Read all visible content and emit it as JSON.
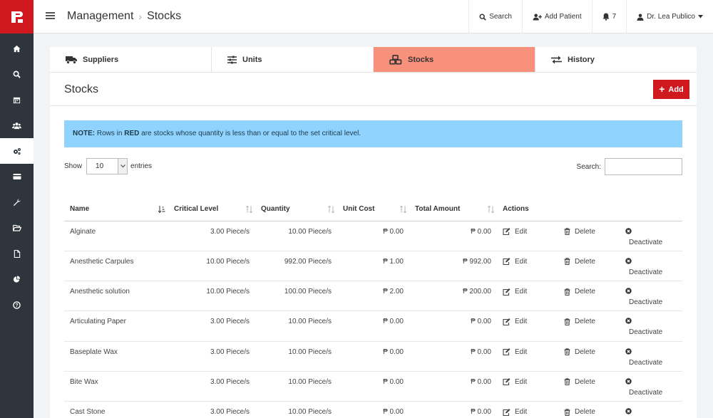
{
  "topbar": {
    "breadcrumb": [
      "Management",
      "Stocks"
    ],
    "search_label": "Search",
    "add_patient_label": "Add Patient",
    "notification_count": "7",
    "user_label": "Dr. Lea Publico"
  },
  "sidebar": {
    "items": [
      "home-icon",
      "search-icon",
      "calendar-icon",
      "users-icon",
      "cogs-icon",
      "credit-card-icon",
      "wrench-icon",
      "folder-open-icon",
      "file-icon",
      "pie-chart-icon",
      "help-icon"
    ],
    "active_index": 4
  },
  "tabs": [
    {
      "label": "Suppliers",
      "icon": "truck-icon"
    },
    {
      "label": "Units",
      "icon": "sliders-icon"
    },
    {
      "label": "Stocks",
      "icon": "cubes-icon",
      "active": true
    },
    {
      "label": "History",
      "icon": "exchange-icon"
    }
  ],
  "panel": {
    "title": "Stocks",
    "add_label": "Add"
  },
  "note": {
    "prefix": "NOTE:",
    "text_before": " Rows in ",
    "highlight": "RED",
    "text_after": " are stocks whose quantity is less than or equal to the set critical level."
  },
  "controls": {
    "show_label": "Show",
    "entries_value": "10",
    "entries_label": "entries",
    "search_label": "Search:"
  },
  "table": {
    "headers": [
      "Name",
      "Critical Level",
      "Quantity",
      "Unit Cost",
      "Total Amount",
      "Actions"
    ],
    "edit_label": "Edit",
    "delete_label": "Delete",
    "deactivate_label": "Deactivate",
    "rows": [
      {
        "name": "Alginate",
        "critical": "3.00 Piece/s",
        "quantity": "10.00 Piece/s",
        "unit_cost": "₱ 0.00",
        "total": "₱ 0.00"
      },
      {
        "name": "Anesthetic Carpules",
        "critical": "10.00 Piece/s",
        "quantity": "992.00 Piece/s",
        "unit_cost": "₱ 1.00",
        "total": "₱ 992.00"
      },
      {
        "name": "Anesthetic solution",
        "critical": "10.00 Piece/s",
        "quantity": "100.00 Piece/s",
        "unit_cost": "₱ 2.00",
        "total": "₱ 200.00"
      },
      {
        "name": "Articulating Paper",
        "critical": "3.00 Piece/s",
        "quantity": "10.00 Piece/s",
        "unit_cost": "₱ 0.00",
        "total": "₱ 0.00"
      },
      {
        "name": "Baseplate Wax",
        "critical": "3.00 Piece/s",
        "quantity": "10.00 Piece/s",
        "unit_cost": "₱ 0.00",
        "total": "₱ 0.00"
      },
      {
        "name": "Bite Wax",
        "critical": "3.00 Piece/s",
        "quantity": "10.00 Piece/s",
        "unit_cost": "₱ 0.00",
        "total": "₱ 0.00"
      },
      {
        "name": "Cast Stone",
        "critical": "3.00 Piece/s",
        "quantity": "10.00 Piece/s",
        "unit_cost": "₱ 0.00",
        "total": "₱ 0.00"
      }
    ]
  },
  "colors": {
    "brand_red": "#d0181f",
    "sidebar_bg": "#2f353d",
    "active_tab": "#f7917b",
    "note_bg": "#8fd3fe"
  }
}
